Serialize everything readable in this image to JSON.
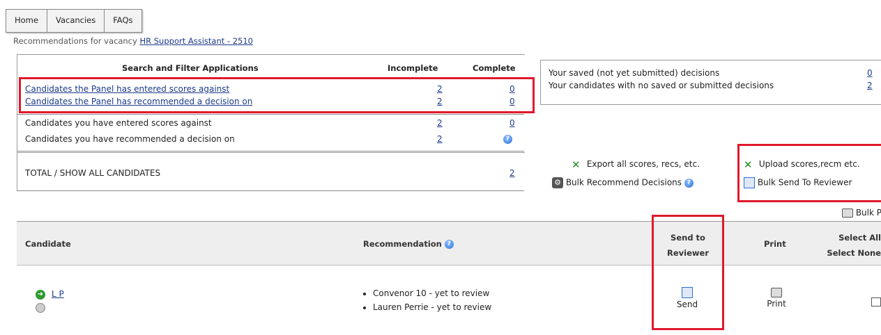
{
  "nav": {
    "tabs": [
      "Home",
      "Vacancies",
      "FAQs"
    ]
  },
  "subtitle": {
    "prefix": "Recommendations for vacancy ",
    "vacancy_link": "HR Support Assistant - 2510"
  },
  "filter": {
    "title": "Search and Filter Applications",
    "col_incomplete": "Incomplete",
    "col_complete": "Complete",
    "rows": [
      {
        "label": "Candidates the Panel has entered scores against",
        "incomplete": "2",
        "complete": "0"
      },
      {
        "label": "Candidates the Panel has recommended a decision on",
        "incomplete": "2",
        "complete": "0"
      },
      {
        "label": "Candidates you have entered scores against",
        "incomplete": "2",
        "complete": "0"
      },
      {
        "label": "Candidates you have recommended a decision on",
        "incomplete": "2"
      }
    ],
    "total_label": "TOTAL / SHOW ALL CANDIDATES",
    "total_value": "2"
  },
  "saved": {
    "rows": [
      {
        "label": "Your saved (not yet submitted) decisions",
        "value": "0"
      },
      {
        "label": "Your candidates with no saved or submitted decisions",
        "value": "2"
      }
    ]
  },
  "actions": {
    "export": "Export all scores, recs, etc.",
    "bulk_recommend": "Bulk Recommend Decisions",
    "upload": "Upload scores,recm etc.",
    "bulk_send": "Bulk Send To Reviewer",
    "bulk_print": "Bulk Prin"
  },
  "table": {
    "headers": {
      "candidate": "Candidate",
      "recommendation": "Recommendation",
      "send_line1": "Send to",
      "send_line2": "Reviewer",
      "print": "Print",
      "select_all": "Select All",
      "select_none": "Select None"
    },
    "rows": [
      {
        "candidate": "L P",
        "recommendations": [
          "Convenor 10 - yet to review",
          "Lauren Perrie - yet to review"
        ],
        "send": "Send",
        "print": "Print"
      }
    ]
  },
  "colors": {
    "highlight": "#e0192c",
    "link": "#1a3a8a"
  }
}
